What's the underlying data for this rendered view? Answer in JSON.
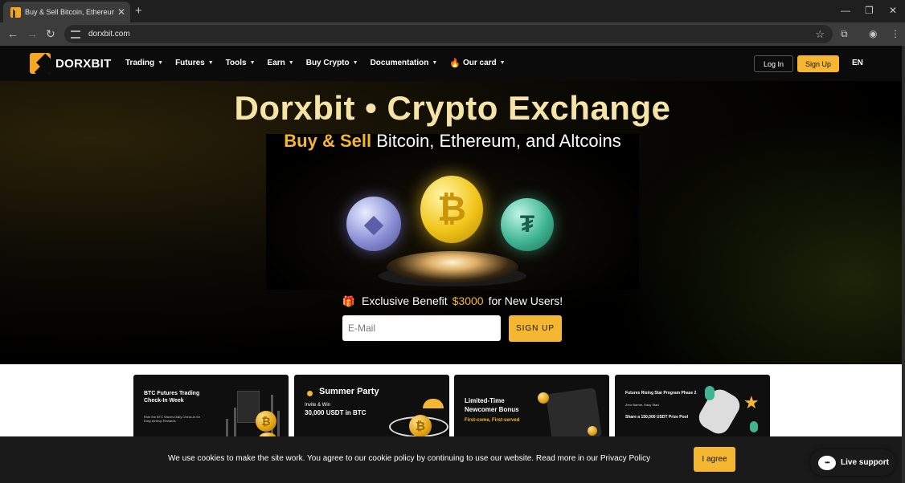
{
  "browser": {
    "tab_title": "Buy & Sell Bitcoin, Ethereum | C",
    "tab_close": "✕",
    "new_tab": "+",
    "url": "dorxbit.com"
  },
  "header": {
    "brand": "DORXBIT",
    "menu": [
      "Trading",
      "Futures",
      "Tools",
      "Earn",
      "Buy Crypto",
      "Documentation",
      "Our card"
    ],
    "login": "Log In",
    "signup": "Sign Up",
    "lang": "EN"
  },
  "hero": {
    "title": "Dorxbit • Crypto Exchange",
    "subtitle_accent": "Buy & Sell",
    "subtitle_rest": "Bitcoin, Ethereum, and Altcoins",
    "benefit_pre": "Exclusive Benefit",
    "benefit_amount": "$3000",
    "benefit_post": "for New Users!",
    "email_placeholder": "E-Mail",
    "signup_button": "SIGN UP"
  },
  "promos": {
    "card1": {
      "title": "BTC Futures Trading Check-In Week",
      "sub": "Ride the BTC Waves Daily Check-In for Easy Airdrop Rewards"
    },
    "card2": {
      "title": "Summer Party",
      "line1": "Invite & Win",
      "line2": "30,000 USDT in BTC"
    },
    "card3": {
      "title": "Limited-Time Newcomer Bonus",
      "line": "First-come, First-served"
    },
    "card4": {
      "title": "Futures Rising Star Program Phase 2",
      "line1": "Zero Barrier, Easy Start",
      "line2": "Share a 150,000 USDT Prize Pool"
    }
  },
  "cookie": {
    "message": "We use cookies to make the site work. You agree to our cookie policy by continuing to use our website. Read more in our Privacy Policy",
    "agree": "I agree"
  },
  "support": {
    "label": "Live support"
  },
  "colors": {
    "accent": "#f5b731",
    "title": "#f6e3a6",
    "header_bg": "#0b0b0b"
  }
}
